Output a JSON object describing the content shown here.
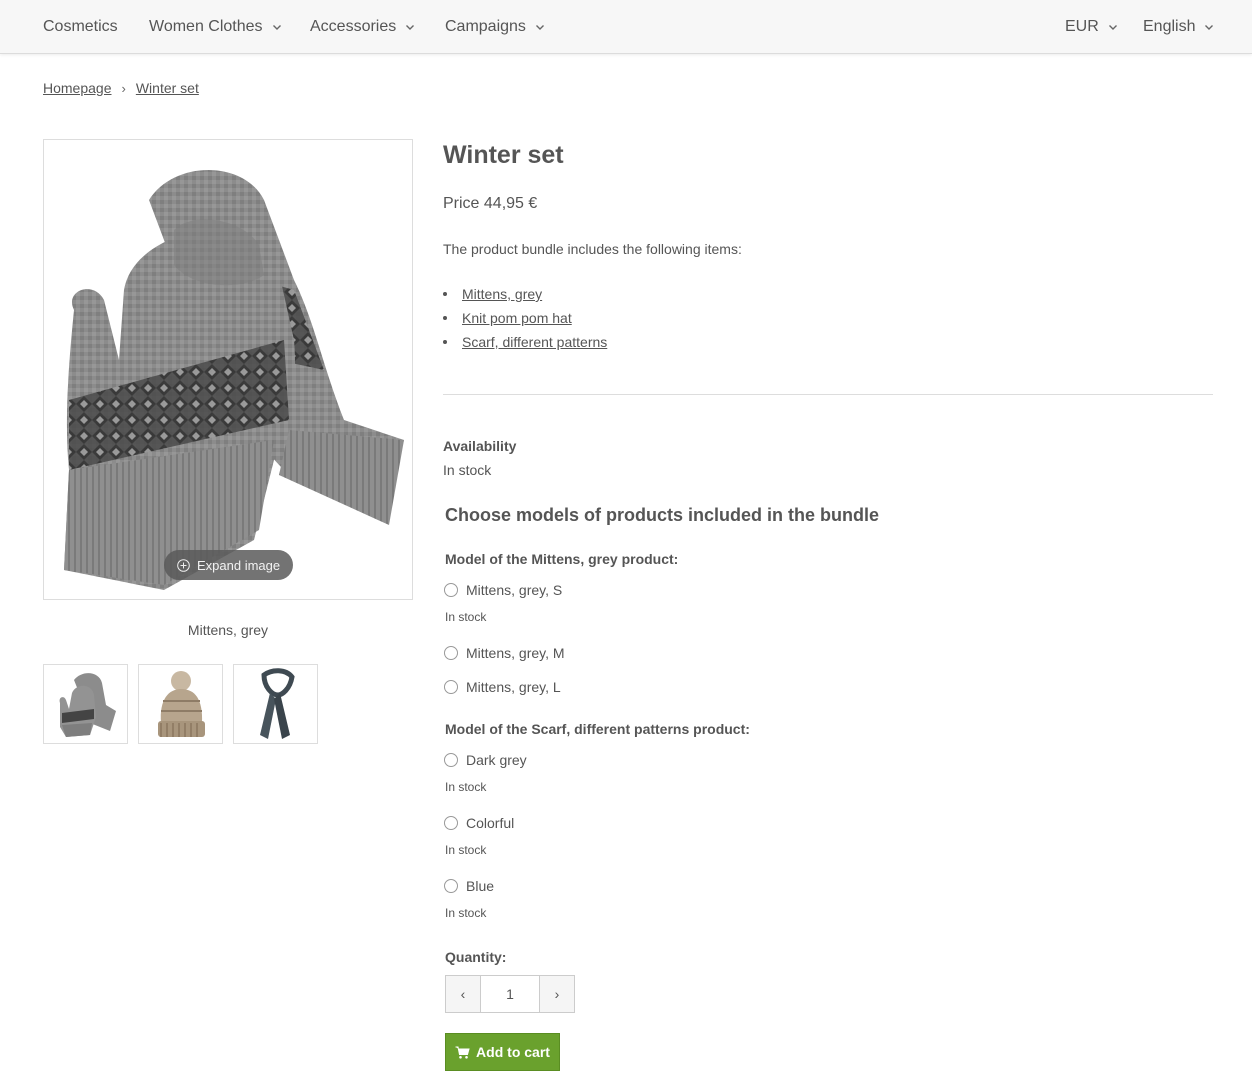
{
  "nav": {
    "items": [
      {
        "label": "Cosmetics",
        "dropdown": false
      },
      {
        "label": "Women Clothes",
        "dropdown": true
      },
      {
        "label": "Accessories",
        "dropdown": true
      },
      {
        "label": "Campaigns",
        "dropdown": true
      }
    ],
    "currency": "EUR",
    "language": "English"
  },
  "breadcrumb": {
    "home": "Homepage",
    "separator": "›",
    "current": "Winter set"
  },
  "gallery": {
    "expand_label": "Expand image",
    "caption": "Mittens, grey",
    "thumbnails": [
      "mittens-image",
      "pom-pom-hat-image",
      "scarf-image"
    ]
  },
  "product": {
    "title": "Winter set",
    "price": "Price 44,95 €",
    "bundle_intro": "The product bundle includes the following items:",
    "bundle_items": [
      "Mittens, grey",
      "Knit pom pom hat",
      "Scarf, different patterns"
    ],
    "availability_label": "Availability",
    "availability_value": "In stock",
    "choose_heading": "Choose models of products included in the bundle"
  },
  "models": {
    "mittens": {
      "label": "Model of the Mittens, grey product:",
      "options": [
        {
          "label": "Mittens, grey, S",
          "stock": "In stock"
        },
        {
          "label": "Mittens, grey, M",
          "stock": ""
        },
        {
          "label": "Mittens, grey, L",
          "stock": ""
        }
      ]
    },
    "scarf": {
      "label": "Model of the Scarf, different patterns product:",
      "options": [
        {
          "label": "Dark grey",
          "stock": "In stock"
        },
        {
          "label": "Colorful",
          "stock": "In stock"
        },
        {
          "label": "Blue",
          "stock": "In stock"
        }
      ]
    }
  },
  "quantity": {
    "label": "Quantity:",
    "value": "1",
    "decrement_icon": "‹",
    "increment_icon": "›"
  },
  "cart": {
    "label": "Add to cart",
    "color": "#6aa12d"
  }
}
